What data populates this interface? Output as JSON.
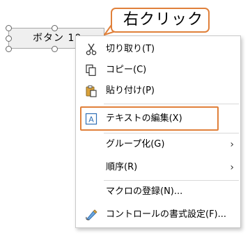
{
  "form_control": {
    "label": "ボタン 10"
  },
  "callout": {
    "text": "右クリック",
    "border_color": "#e0803a"
  },
  "context_menu": {
    "items": [
      {
        "label": "切り取り(T)",
        "icon": "scissors-icon"
      },
      {
        "label": "コピー(C)",
        "icon": "copy-icon"
      },
      {
        "label": "貼り付け(P)",
        "icon": "paste-icon"
      },
      {
        "label": "テキストの編集(X)",
        "icon": "edit-text-icon",
        "highlighted": true
      },
      {
        "label": "グループ化(G)",
        "submenu": true
      },
      {
        "label": "順序(R)",
        "submenu": true
      },
      {
        "label": "マクロの登録(N)..."
      },
      {
        "label": "コントロールの書式設定(F)...",
        "icon": "format-control-icon"
      }
    ],
    "submenu_arrow": "›"
  },
  "colors": {
    "highlight": "#e0803a",
    "icon_blue": "#2f6fb5",
    "icon_gold": "#d9a13a"
  }
}
